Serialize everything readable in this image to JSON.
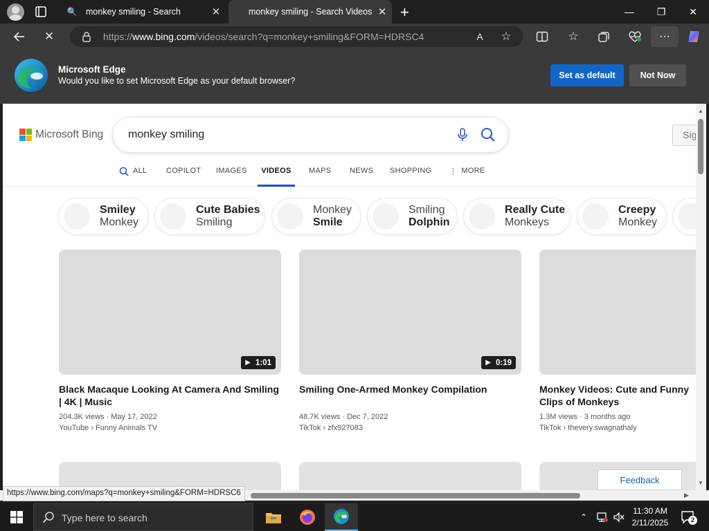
{
  "browser": {
    "tabs": [
      {
        "title": "monkey smiling - Search"
      },
      {
        "title": "monkey smiling - Search Videos"
      }
    ],
    "window_controls": {
      "minimize": "—",
      "restore": "❐",
      "close": "✕"
    },
    "address": {
      "url_prefix": "https://",
      "url_domain": "www.bing.com",
      "url_path": "/videos/search?q=monkey+smiling&FORM=HDRSC4"
    },
    "reload_icon": "✕",
    "read_aloud": "A",
    "more": "···"
  },
  "banner": {
    "heading": "Microsoft Edge",
    "text": "Would you like to set Microsoft Edge as your default browser?",
    "primary_button": "Set as default",
    "secondary_button": "Not Now"
  },
  "bing": {
    "logo_text": "Microsoft Bing",
    "query": "monkey smiling",
    "signin": "Sig",
    "tabs": [
      {
        "label": "ALL"
      },
      {
        "label": "COPILOT"
      },
      {
        "label": "IMAGES"
      },
      {
        "label": "VIDEOS"
      },
      {
        "label": "MAPS"
      },
      {
        "label": "NEWS"
      },
      {
        "label": "SHOPPING"
      },
      {
        "label": "MORE"
      }
    ],
    "chips": [
      {
        "bold": "Smiley",
        "rest": "Monkey"
      },
      {
        "bold": "Cute Babies",
        "rest": "Smiling"
      },
      {
        "rest": "Monkey",
        "bold": "Smile"
      },
      {
        "rest": "Smiling",
        "bold": "Dolphin"
      },
      {
        "bold": "Really Cute",
        "rest": "Monkeys"
      },
      {
        "bold": "Creepy",
        "rest": "Monkey"
      }
    ],
    "videos": [
      {
        "duration": "1:01",
        "title": "Black Macaque Looking At Camera And Smiling | 4K | Music",
        "meta": "204.3K views · May 17, 2022",
        "source": "YouTube › Funny Animals TV"
      },
      {
        "duration": "0:19",
        "title": "Smiling One-Armed Monkey Compilation",
        "meta": "48.7K views · Dec 7, 2022",
        "source": "TikTok › zfx927083"
      },
      {
        "duration": "",
        "title": "Monkey Videos: Cute and Funny Clips of Monkeys",
        "meta": "1.3M views · 3 months ago",
        "source": "TikTok › thevery.swagnathaly"
      }
    ],
    "feedback": "Feedback"
  },
  "status_url": "https://www.bing.com/maps?q=monkey+smiling&FORM=HDRSC6",
  "taskbar": {
    "search_placeholder": "Type here to search",
    "time": "11:30 AM",
    "date": "2/11/2025",
    "notification_count": "2"
  },
  "colors": {
    "edge_blue": "#1266c8",
    "bing_active_tab": "#174ae4",
    "ms_red": "#f25022",
    "ms_green": "#7fba00",
    "ms_blue": "#00a4ef",
    "ms_yellow": "#ffb900"
  }
}
